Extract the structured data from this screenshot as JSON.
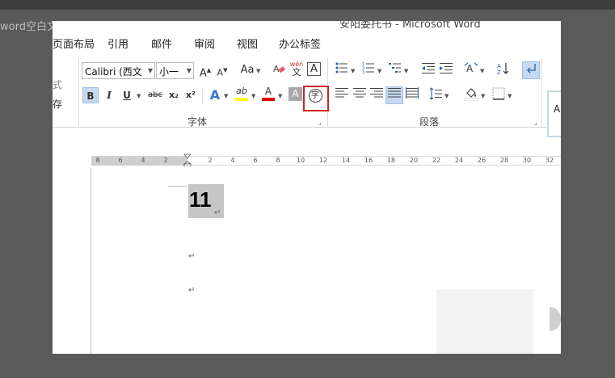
{
  "window": {
    "title": "安阳委托书 - Microsoft Word"
  },
  "background": {
    "doc_name": "word空白文",
    "side_labels": [
      "式",
      "存"
    ]
  },
  "menu": [
    "页面布局",
    "引用",
    "邮件",
    "审阅",
    "视图",
    "办公标签"
  ],
  "ribbon": {
    "font_name": "Calibri (西文",
    "font_size": "小一",
    "group_font_label": "字体",
    "group_paragraph_label": "段落",
    "styles_preview": "A",
    "buttons": {
      "grow_font": "A",
      "shrink_font": "A",
      "change_case": "Aa",
      "phonetic": "wén",
      "phonetic_char": "文",
      "char_border": "A",
      "bold": "B",
      "italic": "I",
      "underline": "U",
      "strikethrough": "abc",
      "subscript": "x₂",
      "superscript": "x²",
      "text_effect": "A",
      "highlight": "ab",
      "font_color": "A",
      "char_shading": "A",
      "enclose_char": "字"
    }
  },
  "ruler": {
    "ticks": [
      "8",
      "6",
      "4",
      "2",
      "2",
      "4",
      "6",
      "8",
      "10",
      "12",
      "14",
      "16",
      "18",
      "20",
      "22",
      "24",
      "26",
      "28",
      "30",
      "32"
    ]
  },
  "document": {
    "line1": "11",
    "paragraph_mark": "↵"
  },
  "colors": {
    "highlight_yellow": "#ffff00",
    "font_red": "#e00000",
    "selection_gray": "#c6c6c6",
    "callout_red": "#d02020"
  }
}
